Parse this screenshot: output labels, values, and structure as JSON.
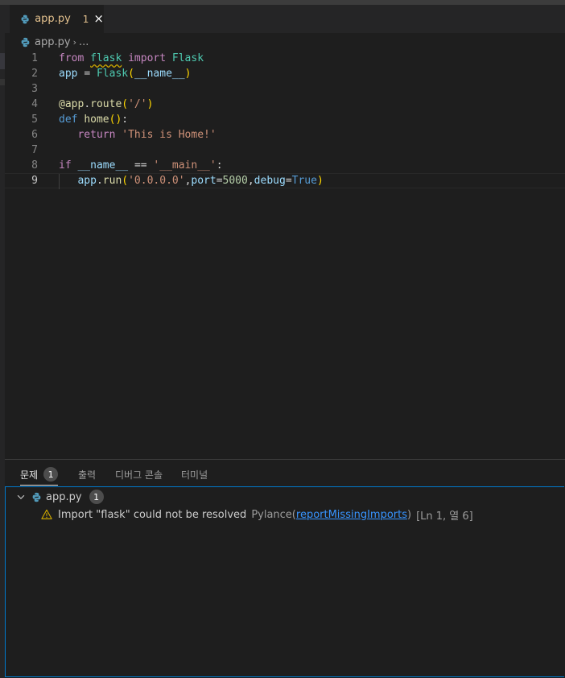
{
  "tab": {
    "filename": "app.py",
    "problem_count": "1",
    "close_icon": "×"
  },
  "breadcrumb": {
    "file": "app.py",
    "separator": "›",
    "ellipsis": "..."
  },
  "editor": {
    "line_numbers": [
      "1",
      "2",
      "3",
      "4",
      "5",
      "6",
      "7",
      "8",
      "9"
    ],
    "lines": {
      "l1": {
        "from": "from",
        "module": "flask",
        "import": "import",
        "name": "Flask"
      },
      "l2": {
        "var": "app",
        "eq": "=",
        "cls": "Flask",
        "open": "(",
        "arg": "__name__",
        "close": ")"
      },
      "l4": {
        "at": "@",
        "obj": "app",
        "dot": ".",
        "fn": "route",
        "open": "(",
        "str": "'/'",
        "close": ")"
      },
      "l5": {
        "def": "def",
        "fn": "home",
        "parens": "()",
        "colon": ":"
      },
      "l6": {
        "ret": "return",
        "str": "'This is Home!'"
      },
      "l8": {
        "if": "if",
        "var": "__name__",
        "eq": "==",
        "str": "'__main__'",
        "colon": ":"
      },
      "l9": {
        "obj": "app",
        "dot": ".",
        "fn": "run",
        "open": "(",
        "host": "'0.0.0.0'",
        "comma1": ",",
        "port_kw": "port",
        "eq1": "=",
        "port": "5000",
        "comma2": ",",
        "debug_kw": "debug",
        "eq2": "=",
        "debug": "True",
        "close": ")"
      }
    }
  },
  "panel": {
    "tabs": [
      "문제",
      "출력",
      "디버그 콘솔",
      "터미널"
    ],
    "problems_badge": "1",
    "problems": {
      "file": "app.py",
      "file_count": "1",
      "message": "Import \"flask\" could not be resolved",
      "source": "Pylance(",
      "code": "reportMissingImports",
      "source_close": ")",
      "location": "[Ln 1, 열 6]"
    }
  },
  "colors": {
    "accent": "#007acc",
    "warning": "#cca700",
    "background": "#1e1e1e"
  }
}
